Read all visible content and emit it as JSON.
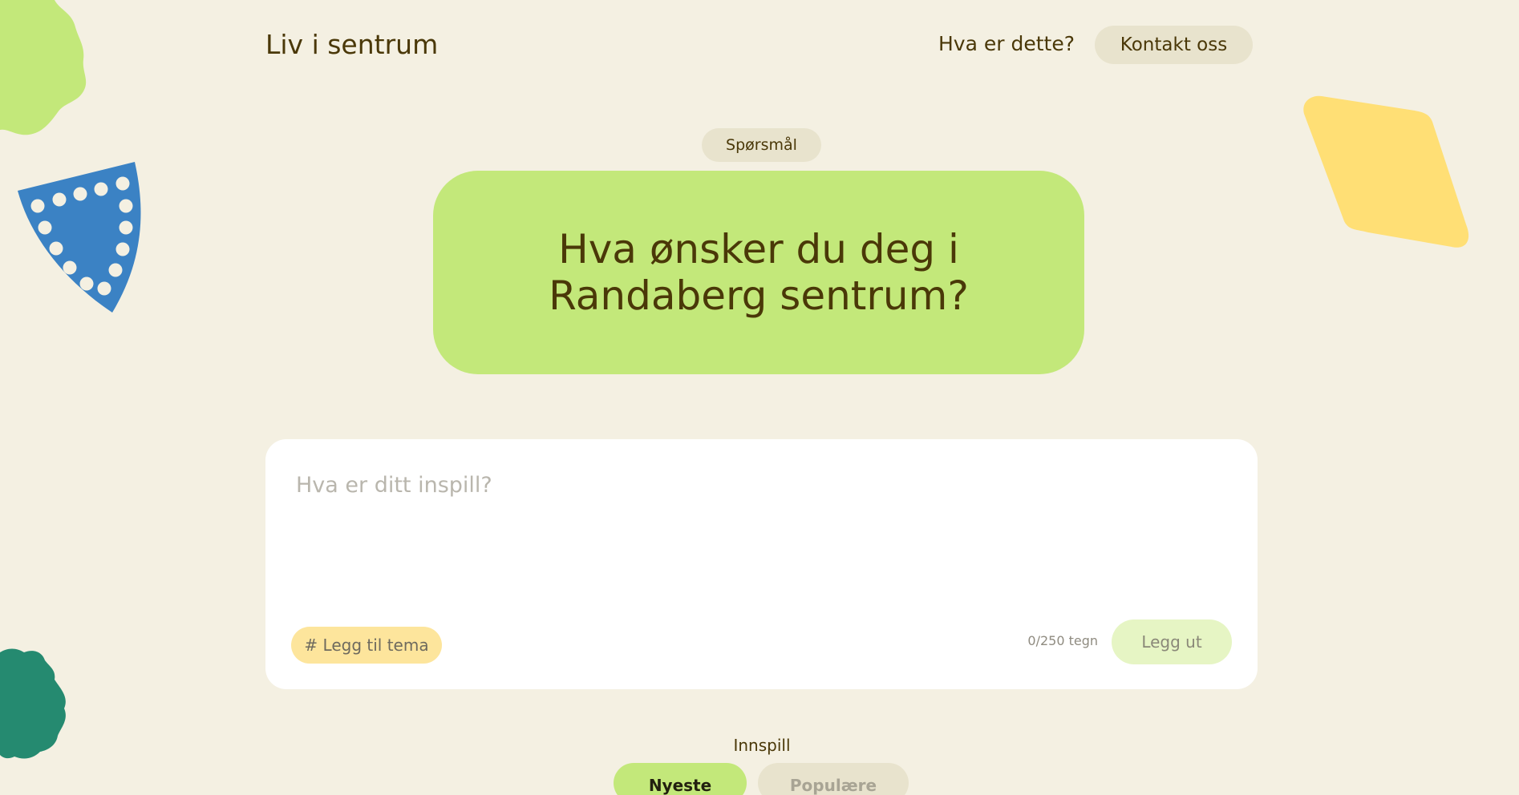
{
  "header": {
    "site_title": "Liv i sentrum",
    "nav_about": "Hva er dette?",
    "nav_contact": "Kontakt oss"
  },
  "question": {
    "chip_label": "Spørsmål",
    "text": "Hva ønsker du deg i Randaberg sentrum?"
  },
  "composer": {
    "placeholder": "Hva er ditt inspill?",
    "value": "",
    "add_topic_label": "# Legg til tema",
    "char_counter": "0/250 tegn",
    "publish_label": "Legg ut"
  },
  "feed": {
    "section_label": "Innspill",
    "tabs": [
      {
        "label": "Nyeste",
        "active": true
      },
      {
        "label": "Populære",
        "active": false
      }
    ]
  },
  "colors": {
    "background": "#f4f0e2",
    "accent_green": "#c3e87a",
    "accent_yellow": "#fde59c",
    "shape_blue": "#3b82c4",
    "shape_teal": "#258a70",
    "shape_yellow": "#ffdf75",
    "text_brown": "#4a3808"
  }
}
